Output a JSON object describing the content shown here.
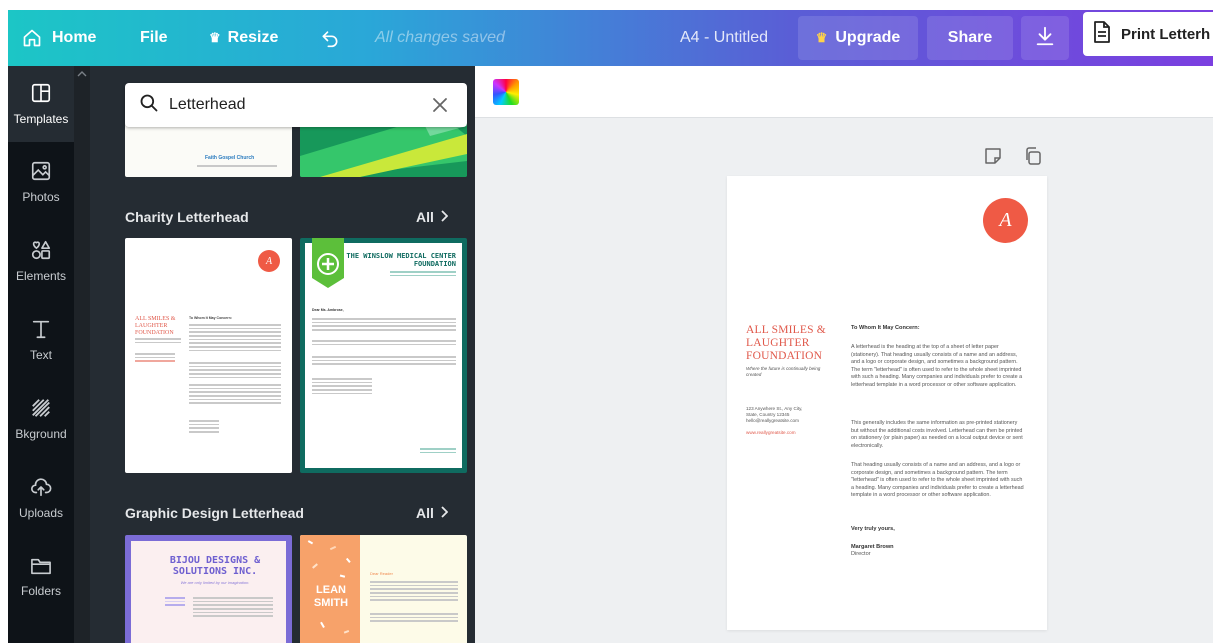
{
  "topbar": {
    "home": "Home",
    "file": "File",
    "resize": "Resize",
    "saved_status": "All changes saved",
    "doc_title": "A4 - Untitled",
    "upgrade": "Upgrade",
    "share": "Share",
    "print": "Print Letterh"
  },
  "sidebar": {
    "items": [
      {
        "label": "Templates"
      },
      {
        "label": "Photos"
      },
      {
        "label": "Elements"
      },
      {
        "label": "Text"
      },
      {
        "label": "Bkground"
      },
      {
        "label": "Uploads"
      },
      {
        "label": "Folders"
      }
    ]
  },
  "panel": {
    "search_value": "Letterhead",
    "top_thumb_text": "Faith Gospel Church",
    "sections": [
      {
        "title": "Charity Letterhead",
        "all": "All"
      },
      {
        "title": "Graphic Design Letterhead",
        "all": "All"
      }
    ],
    "charity_1": {
      "org": "ALL SMILES & LAUGHTER FOUNDATION",
      "greeting": "To Whom It May Concern:"
    },
    "charity_2": {
      "org": "THE WINSLOW MEDICAL CENTER FOUNDATION",
      "greeting": "Dear Ms. Ambrose,"
    },
    "graphic_1": {
      "org": "BIJOU DESIGNS & SOLUTIONS INC.",
      "tagline": "We are only limited by our imagination."
    },
    "graphic_2": {
      "name": "LEAN SMITH",
      "greeting": "Dear Reader"
    }
  },
  "document": {
    "org_name": "ALL SMILES & LAUGHTER FOUNDATION",
    "tagline": "Where the future is continually being created",
    "address_1": "123 Anywhere St., Any City,",
    "address_2": "State, Country 12345",
    "email": "hello@reallygreatsite.com",
    "website": "www.reallygreatsite.com",
    "greeting": "To Whom It May Concern:",
    "para_1": "A letterhead is the heading at the top of a sheet of letter paper (stationery). That heading usually consists of a name and an address, and a logo or corporate design, and sometimes a background pattern. The term \"letterhead\" is often used to refer to the whole sheet imprinted with such a heading. Many companies and individuals prefer to create a letterhead template in a word processor or other software application.",
    "para_2": "This generally includes the same information as pre-printed stationery but without the additional costs involved. Letterhead can then be printed on stationery (or plain paper) as needed on a local output device or sent electronically.",
    "para_3": "That heading usually consists of a name and an address, and a logo or corporate design, and sometimes a background pattern. The term \"letterhead\" is often used to refer to the whole sheet imprinted with such a heading. Many companies and individuals prefer to create a letterhead template in a word processor or other software application.",
    "closing": "Very truly yours,",
    "signer_name": "Margaret Brown",
    "signer_title": "Director",
    "logo_letter": "A"
  },
  "colors": {
    "accent_red": "#ef5a45",
    "text_red": "#e0584a",
    "panel_bg": "#252c33",
    "nav_bg": "#0e1318"
  }
}
